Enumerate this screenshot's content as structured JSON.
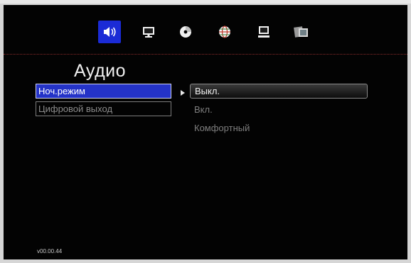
{
  "tabs": [
    {
      "icon": "speaker-icon",
      "active": true
    },
    {
      "icon": "monitor-icon",
      "active": false
    },
    {
      "icon": "disc-icon",
      "active": false
    },
    {
      "icon": "globe-icon",
      "active": false
    },
    {
      "icon": "computer-icon",
      "active": false
    },
    {
      "icon": "photos-icon",
      "active": false
    }
  ],
  "page": {
    "title": "Аудио"
  },
  "menu": {
    "items": [
      {
        "label": "Ноч.режим",
        "selected": true
      },
      {
        "label": "Цифровой выход",
        "selected": false
      }
    ]
  },
  "options": {
    "items": [
      {
        "label": "Выкл.",
        "selected": true
      },
      {
        "label": "Вкл.",
        "selected": false
      },
      {
        "label": "Комфортный",
        "selected": false
      }
    ]
  },
  "footer": {
    "version": "v00.00.44"
  },
  "colors": {
    "accent": "#1b2bd6",
    "selection": "#2433c8",
    "background": "#030303",
    "divider": "#8a2a2a"
  }
}
